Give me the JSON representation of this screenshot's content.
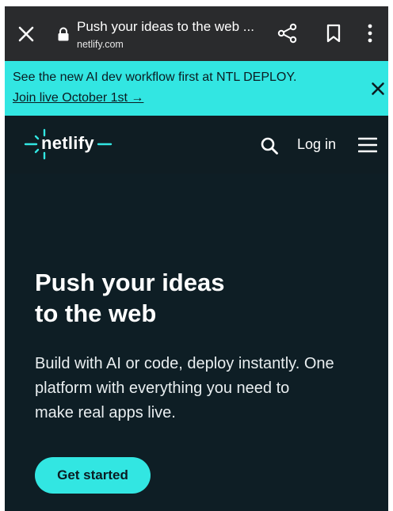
{
  "browser": {
    "page_title": "Push your ideas to the web ...",
    "domain": "netlify.com",
    "icons": [
      "close-icon",
      "lock-icon",
      "share-icon",
      "bookmark-icon",
      "more-vertical-icon"
    ]
  },
  "banner": {
    "message": "See the new AI dev workflow first at NTL DEPLOY.",
    "link_label": "Join live October 1st →",
    "dismiss_icon": "close-icon",
    "color": "#32e6e2"
  },
  "nav": {
    "logo_text": "netlify",
    "login_label": "Log in",
    "icons": [
      "search-icon",
      "hamburger-menu-icon"
    ]
  },
  "hero": {
    "headline_line1": "Push your ideas",
    "headline_line2": "to the web",
    "description_line1": "Build with AI or code, deploy instantly. One",
    "description_line2": "platform with everything you need to",
    "description_line3": "make real apps live.",
    "cta_label": "Get started"
  },
  "colors": {
    "accent": "#32e6e2",
    "background": "#0e1e25",
    "chrome": "#2a2b2d"
  }
}
